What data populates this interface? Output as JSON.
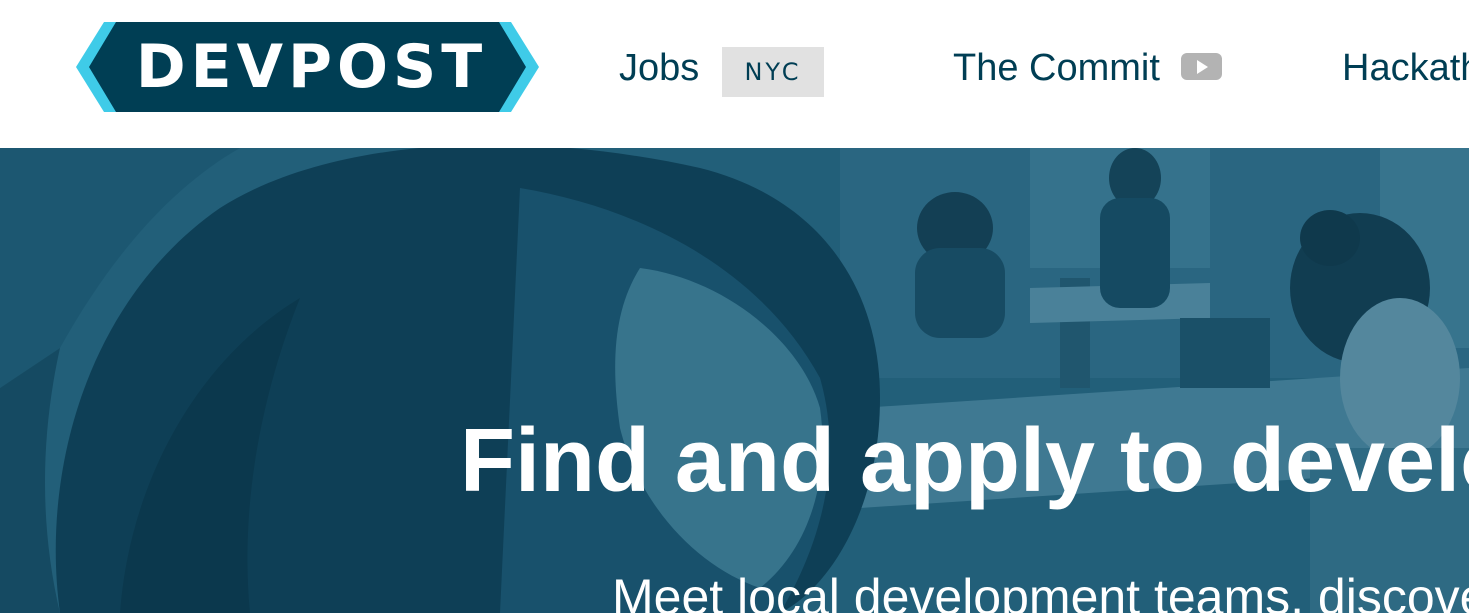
{
  "colors": {
    "brand_dark": "#003e54",
    "brand_cyan": "#3fcbe8",
    "nav_text": "#003e54",
    "badge_bg": "#e1e1e1",
    "hero_overlay": "#1f5f7a",
    "hero_text": "#ffffff"
  },
  "header": {
    "logo_text": "DEVPOST",
    "nav": {
      "jobs_label": "Jobs",
      "jobs_badge": "NYC",
      "commit_label": "The Commit",
      "commit_icon": "play-video-icon",
      "hackathons_label": "Hackathons"
    }
  },
  "hero": {
    "title": "Find and apply to developer jobs",
    "subtitle": "Meet local development teams, discover"
  }
}
